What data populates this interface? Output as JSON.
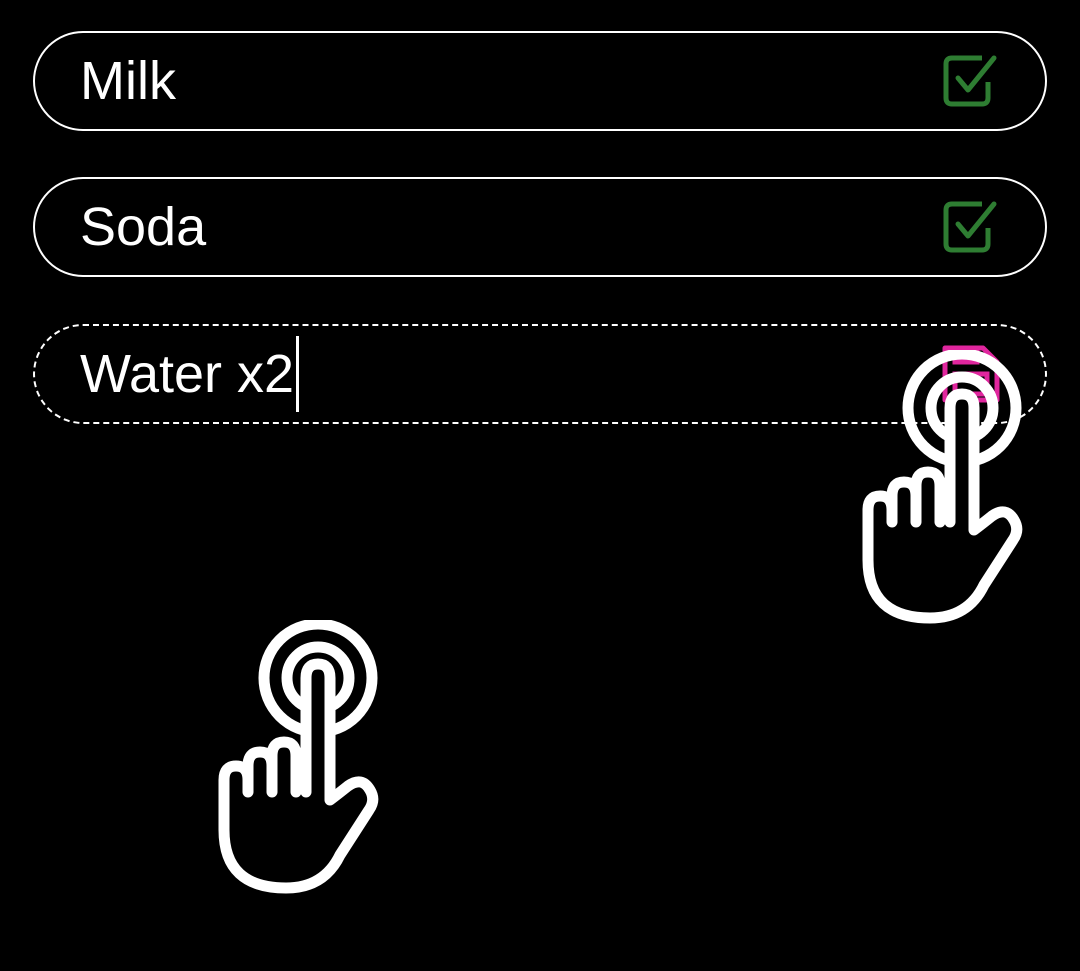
{
  "list": {
    "items": [
      {
        "label": "Milk",
        "status_icon": "checkbox-checked-icon",
        "status_color": "#2e7d32"
      },
      {
        "label": "Soda",
        "status_icon": "checkbox-checked-icon",
        "status_color": "#2e7d32"
      }
    ],
    "editing_item": {
      "value": "Water x2",
      "action_icon": "save-icon",
      "action_color": "#e0269e"
    }
  },
  "gestures": [
    {
      "type": "tap",
      "icon": "tap-gesture-icon",
      "target": "save-button"
    },
    {
      "type": "tap",
      "icon": "tap-gesture-icon",
      "target": "empty-area"
    }
  ]
}
